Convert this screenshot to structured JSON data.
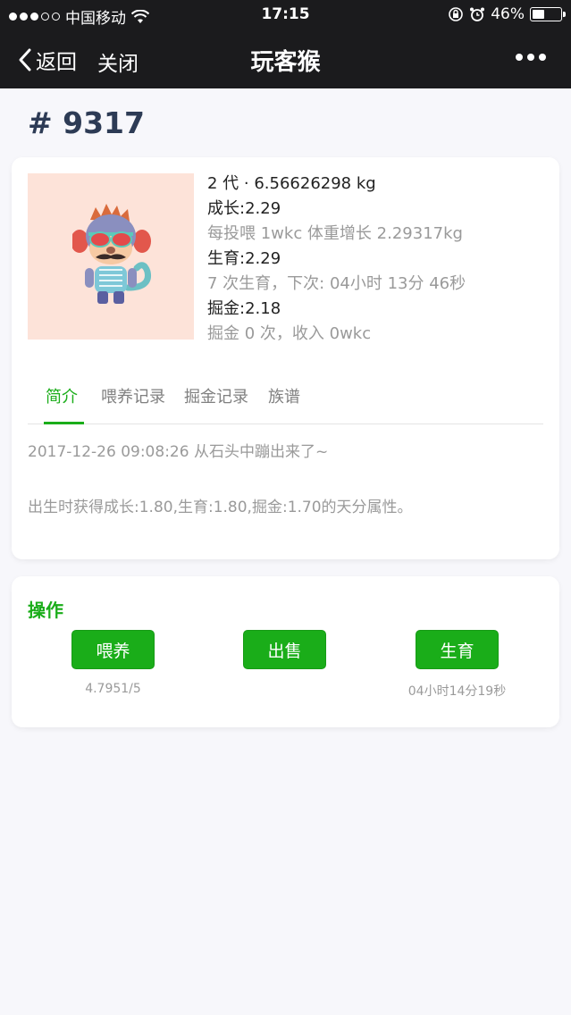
{
  "status_bar": {
    "carrier": "中国移动",
    "time": "17:15",
    "battery": "46%",
    "battery_level": 0.46
  },
  "nav": {
    "back_label": "返回",
    "close_label": "关闭",
    "title": "玩客猴"
  },
  "monkey": {
    "id_label": "# 9317",
    "generation_weight": "2 代 · 6.56626298 kg",
    "growth": "成长:2.29",
    "feed_gain": "每投喂 1wkc 体重增长 2.29317kg",
    "breed": "生育:2.29",
    "breed_info": "7 次生育，下次: 04小时 13分 46秒",
    "mining": "掘金:2.18",
    "mining_info": "掘金 0 次，收入 0wkc"
  },
  "tabs": [
    {
      "label": "简介"
    },
    {
      "label": "喂养记录"
    },
    {
      "label": "掘金记录"
    },
    {
      "label": "族谱"
    }
  ],
  "intro": {
    "line1": "2017-12-26 09:08:26 从石头中蹦出来了~",
    "line2": "出生时获得成长:1.80,生育:1.80,掘金:1.70的天分属性。"
  },
  "operations": {
    "title": "操作",
    "feed_label": "喂养",
    "feed_sub": "4.7951/5",
    "sell_label": "出售",
    "breed_label": "生育",
    "breed_sub": "04小时14分19秒"
  },
  "colors": {
    "accent": "#1aad19",
    "topbar": "#1b1b1d",
    "avatar_bg": "#fde3d9"
  }
}
